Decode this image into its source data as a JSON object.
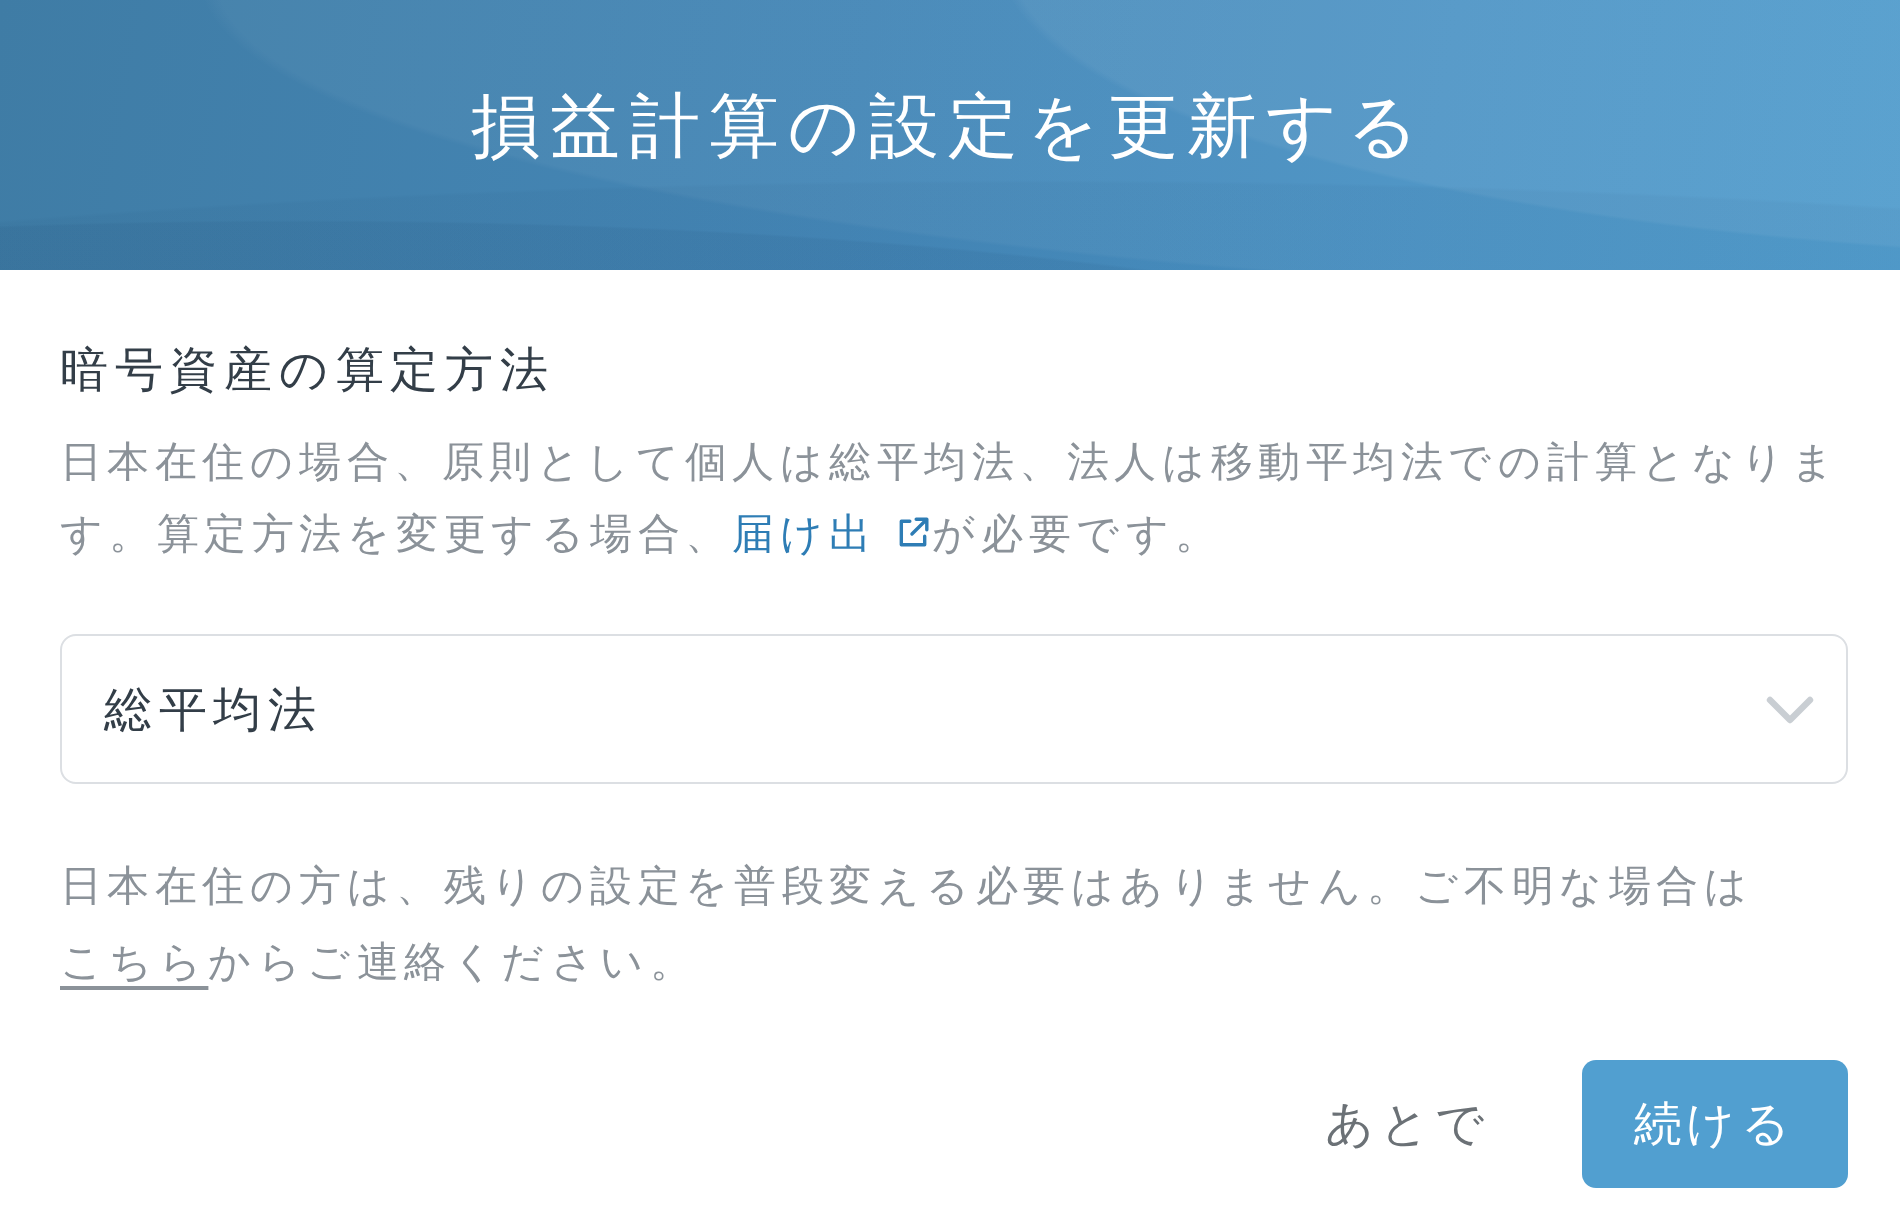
{
  "header": {
    "title": "損益計算の設定を更新する"
  },
  "section": {
    "heading": "暗号資産の算定方法",
    "description": {
      "text_before": "日本在住の場合、原則として個人は総平均法、法人は移動平均法での計算となります。算定方法を変更する場合、",
      "link": "届け出",
      "text_after": "が必要です。"
    }
  },
  "select": {
    "value": "総平均法"
  },
  "note": {
    "text_before": "日本在住の方は、残りの設定を普段変える必要はありません。ご不明な場合は",
    "link": "こちら",
    "text_after": "からご連絡ください。"
  },
  "buttons": [
    {
      "label": "あとで",
      "kind": "text"
    },
    {
      "label": "続ける",
      "kind": "primary"
    }
  ]
}
